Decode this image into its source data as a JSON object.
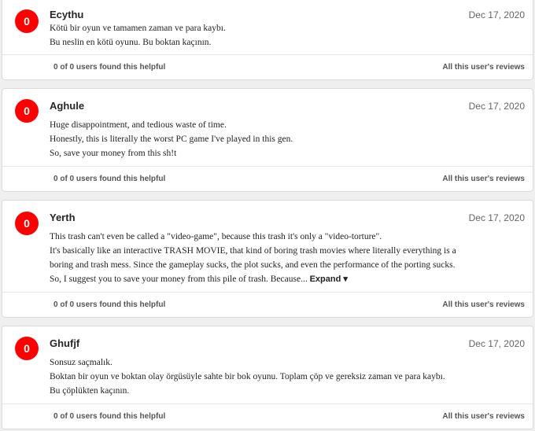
{
  "accent_color": "#ff0000",
  "reviews": [
    {
      "score": "0",
      "author": "Ecythu",
      "date": "Dec 17, 2020",
      "lines": [
        "Kötü bir oyun ve tamamen zaman ve para kaybı.",
        "Bu neslin en kötü oyunu. Bu boktan kaçının."
      ],
      "helpful": "0 of 0 users found this helpful",
      "all_reviews": "All this user's reviews"
    },
    {
      "score": "0",
      "author": "Aghule",
      "date": "Dec 17, 2020",
      "lines": [
        "Huge disappointment, and tedious waste of time.",
        "Honestly, this is literally the worst PC game I've played in this gen.",
        "So, save your money from this sh!t"
      ],
      "helpful": "0 of 0 users found this helpful",
      "all_reviews": "All this user's reviews"
    },
    {
      "score": "0",
      "author": "Yerth",
      "date": "Dec 17, 2020",
      "lines": [
        "This trash can't even be called a \"video-game\", because this trash it's only a \"video-torture\".",
        "It's basically like an interactive TRASH MOVIE, that kind of boring trash movies where literally everything is a",
        "boring and trash mess. Since the gameplay sucks, the plot sucks, and even the performance of the porting sucks.",
        "So, I suggest you to save your money from this pile of trash. Because..."
      ],
      "expand": "Expand ▾",
      "helpful": "0 of 0 users found this helpful",
      "all_reviews": "All this user's reviews"
    },
    {
      "score": "0",
      "author": "Ghufjf",
      "date": "Dec 17, 2020",
      "lines": [
        "Sonsuz saçmalık.",
        "Boktan bir oyun ve boktan olay örgüsüyle sahte bir bok oyunu. Toplam çöp ve gereksiz zaman ve para kaybı.",
        "Bu çöplükten kaçının."
      ],
      "helpful": "0 of 0 users found this helpful",
      "all_reviews": "All this user's reviews"
    }
  ]
}
